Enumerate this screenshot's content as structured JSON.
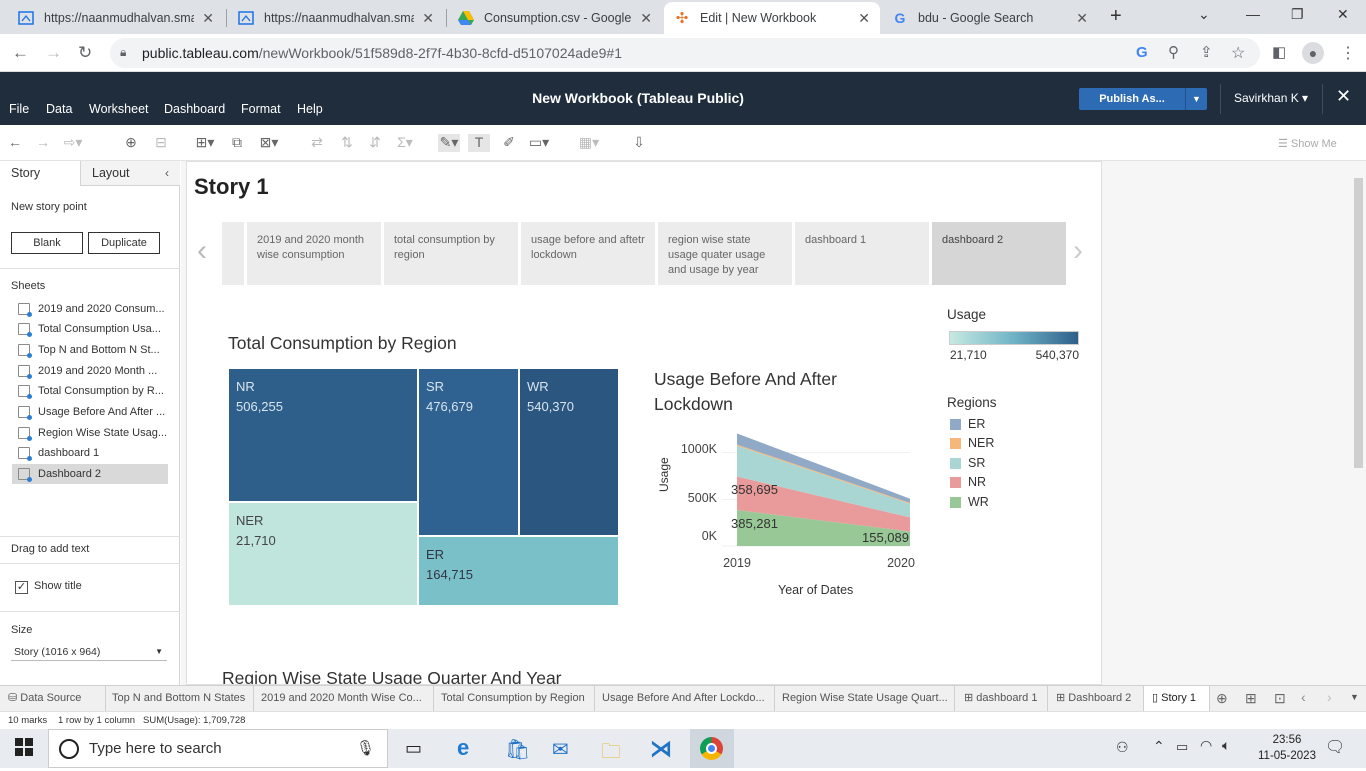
{
  "browser": {
    "tabs": [
      {
        "title": "https://naanmudhalvan.smar",
        "icon": "web-page-icon"
      },
      {
        "title": "https://naanmudhalvan.smar",
        "icon": "web-page-icon"
      },
      {
        "title": "Consumption.csv - Google D",
        "icon": "google-drive-icon"
      },
      {
        "title": "Edit | New Workbook",
        "icon": "tableau-icon"
      },
      {
        "title": "bdu - Google Search",
        "icon": "google-icon"
      }
    ],
    "url_host": "public.tableau.com",
    "url_path": "/newWorkbook/51f589d8-2f7f-4b30-8cfd-d5107024ade9#1"
  },
  "app": {
    "menus": [
      "File",
      "Data",
      "Worksheet",
      "Dashboard",
      "Format",
      "Help"
    ],
    "title": "New Workbook (Tableau Public)",
    "publish_label": "Publish As...",
    "user": "Savirkhan K ▾",
    "show_me": "Show Me"
  },
  "left_pane": {
    "tabs": [
      "Story",
      "Layout"
    ],
    "new_story_point": "New story point",
    "blank_label": "Blank",
    "duplicate_label": "Duplicate",
    "sheets_heading": "Sheets",
    "sheets": [
      "2019 and 2020 Consum...",
      "Total Consumption Usa...",
      "Top N and Bottom N St...",
      "2019 and 2020 Month ...",
      "Total Consumption by R...",
      "Usage Before And After ...",
      "Region Wise State Usag...",
      "dashboard 1",
      "Dashboard 2"
    ],
    "drag_text": "Drag to add text",
    "show_title": "Show title",
    "size_heading": "Size",
    "size_value": "Story (1016 x 964)"
  },
  "story": {
    "title": "Story 1",
    "points": [
      "2019 and 2020 month wise consumption",
      "total consumption by region",
      "usage before  and aftetr lockdown",
      "region wise state usage quater usage and usage by year",
      "dashboard 1",
      "dashboard 2"
    ]
  },
  "treemap": {
    "title": "Total Consumption by Region",
    "cells": [
      {
        "region": "NR",
        "value": "506,255"
      },
      {
        "region": "SR",
        "value": "476,679"
      },
      {
        "region": "WR",
        "value": "540,370"
      },
      {
        "region": "NER",
        "value": "21,710"
      },
      {
        "region": "ER",
        "value": "164,715"
      }
    ]
  },
  "area_chart": {
    "title_line1": "Usage Before  And After",
    "title_line2": "Lockdown",
    "ylabel": "Usage",
    "xlabel": "Year of Dates",
    "yticks": [
      "1000K",
      "500K",
      "0K"
    ],
    "xticks": [
      "2019",
      "2020"
    ],
    "labels": [
      "358,695",
      "385,281",
      "155,089"
    ]
  },
  "chart_data": {
    "type": "area",
    "title": "Usage Before  And After Lockdown",
    "xlabel": "Year of Dates",
    "ylabel": "Usage",
    "categories": [
      "2019",
      "2020"
    ],
    "ylim": [
      0,
      1200000
    ],
    "stacked": true,
    "series": [
      {
        "name": "WR",
        "values": [
          385281,
          155089
        ]
      },
      {
        "name": "NR",
        "values": [
          358695,
          151000
        ]
      },
      {
        "name": "SR",
        "values": [
          330000,
          146000
        ]
      },
      {
        "name": "NER",
        "values": [
          12000,
          9700
        ]
      },
      {
        "name": "ER",
        "values": [
          120000,
          44715
        ]
      }
    ]
  },
  "legends": {
    "usage_title": "Usage",
    "usage_min": "21,710",
    "usage_max": "540,370",
    "regions_title": "Regions",
    "regions": [
      {
        "name": "ER",
        "color": "#8fa9c6"
      },
      {
        "name": "NER",
        "color": "#f5b77a"
      },
      {
        "name": "SR",
        "color": "#a9d6d3"
      },
      {
        "name": "NR",
        "color": "#e99a9a"
      },
      {
        "name": "WR",
        "color": "#98c896"
      }
    ]
  },
  "next_section": "Region Wise State Usage Quarter And Year",
  "sheet_tabs": [
    "Data Source",
    "Top N and Bottom N States",
    "2019 and 2020 Month Wise Co...",
    "Total Consumption by Region",
    "Usage Before And After Lockdo...",
    "Region Wise State Usage Quart...",
    "dashboard 1",
    "Dashboard 2",
    "Story 1"
  ],
  "status": {
    "marks": "10 marks",
    "rows": "1 row by 1 column",
    "sum": "SUM(Usage): 1,709,728"
  },
  "taskbar": {
    "search_placeholder": "Type here to search",
    "time": "23:56",
    "date": "11-05-2023"
  }
}
